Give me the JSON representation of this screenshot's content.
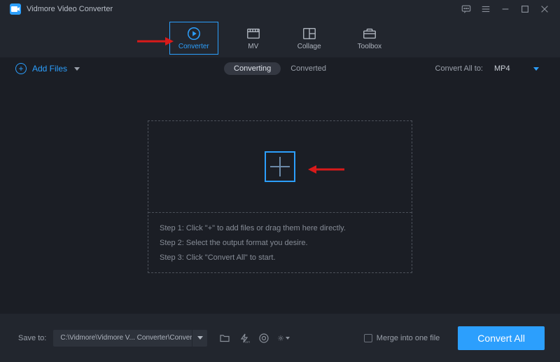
{
  "app": {
    "title": "Vidmore Video Converter"
  },
  "tabs": [
    {
      "label": "Converter",
      "active": true
    },
    {
      "label": "MV"
    },
    {
      "label": "Collage"
    },
    {
      "label": "Toolbox"
    }
  ],
  "toolbar": {
    "add_files_label": "Add Files",
    "seg_converting": "Converting",
    "seg_converted": "Converted",
    "convert_all_to_label": "Convert All to:",
    "format_selected": "MP4"
  },
  "dropzone": {
    "step1": "Step 1: Click \"+\" to add files or drag them here directly.",
    "step2": "Step 2: Select the output format you desire.",
    "step3": "Step 3: Click \"Convert All\" to start."
  },
  "bottom": {
    "save_to_label": "Save to:",
    "path": "C:\\Vidmore\\Vidmore V... Converter\\Converted",
    "merge_label": "Merge into one file",
    "convert_all_btn": "Convert All"
  }
}
